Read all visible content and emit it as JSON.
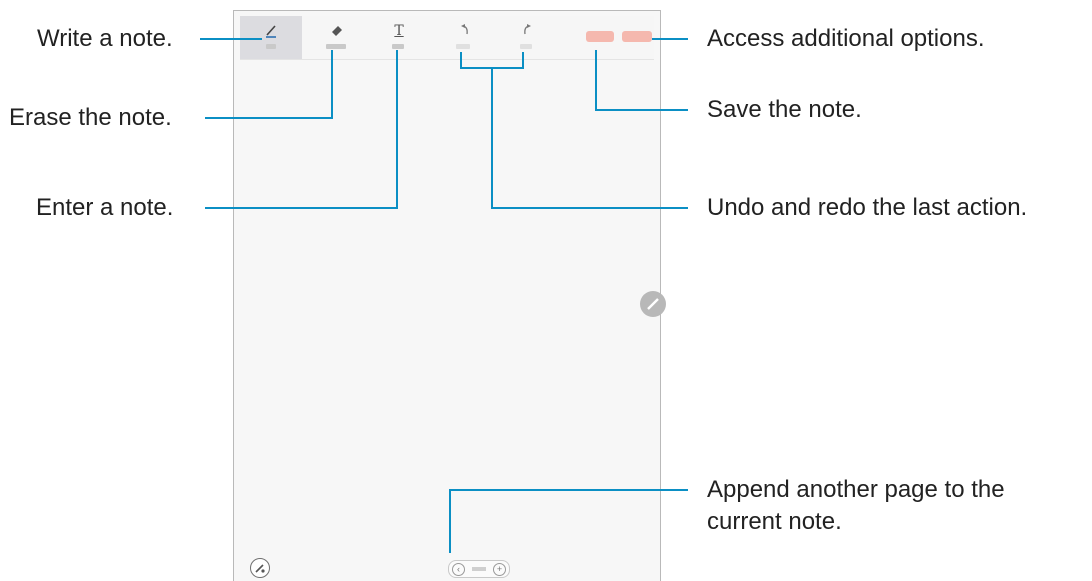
{
  "callouts": {
    "write": "Write a note.",
    "erase": "Erase the note.",
    "enter": "Enter a note.",
    "more": "Access additional options.",
    "save": "Save the note.",
    "undo_redo": "Undo and redo the last action.",
    "append_line1": "Append another page to the",
    "append_line2": "current note."
  },
  "toolbar": {
    "active_tool": "write",
    "icons": [
      "pen-icon",
      "eraser-icon",
      "text-icon",
      "undo-icon",
      "redo-icon"
    ],
    "save_color": "#f5b8ae",
    "more_color": "#f5b8ae"
  },
  "colors": {
    "leader_line": "#0b8fc4",
    "screen_bg": "#f7f7f7"
  }
}
